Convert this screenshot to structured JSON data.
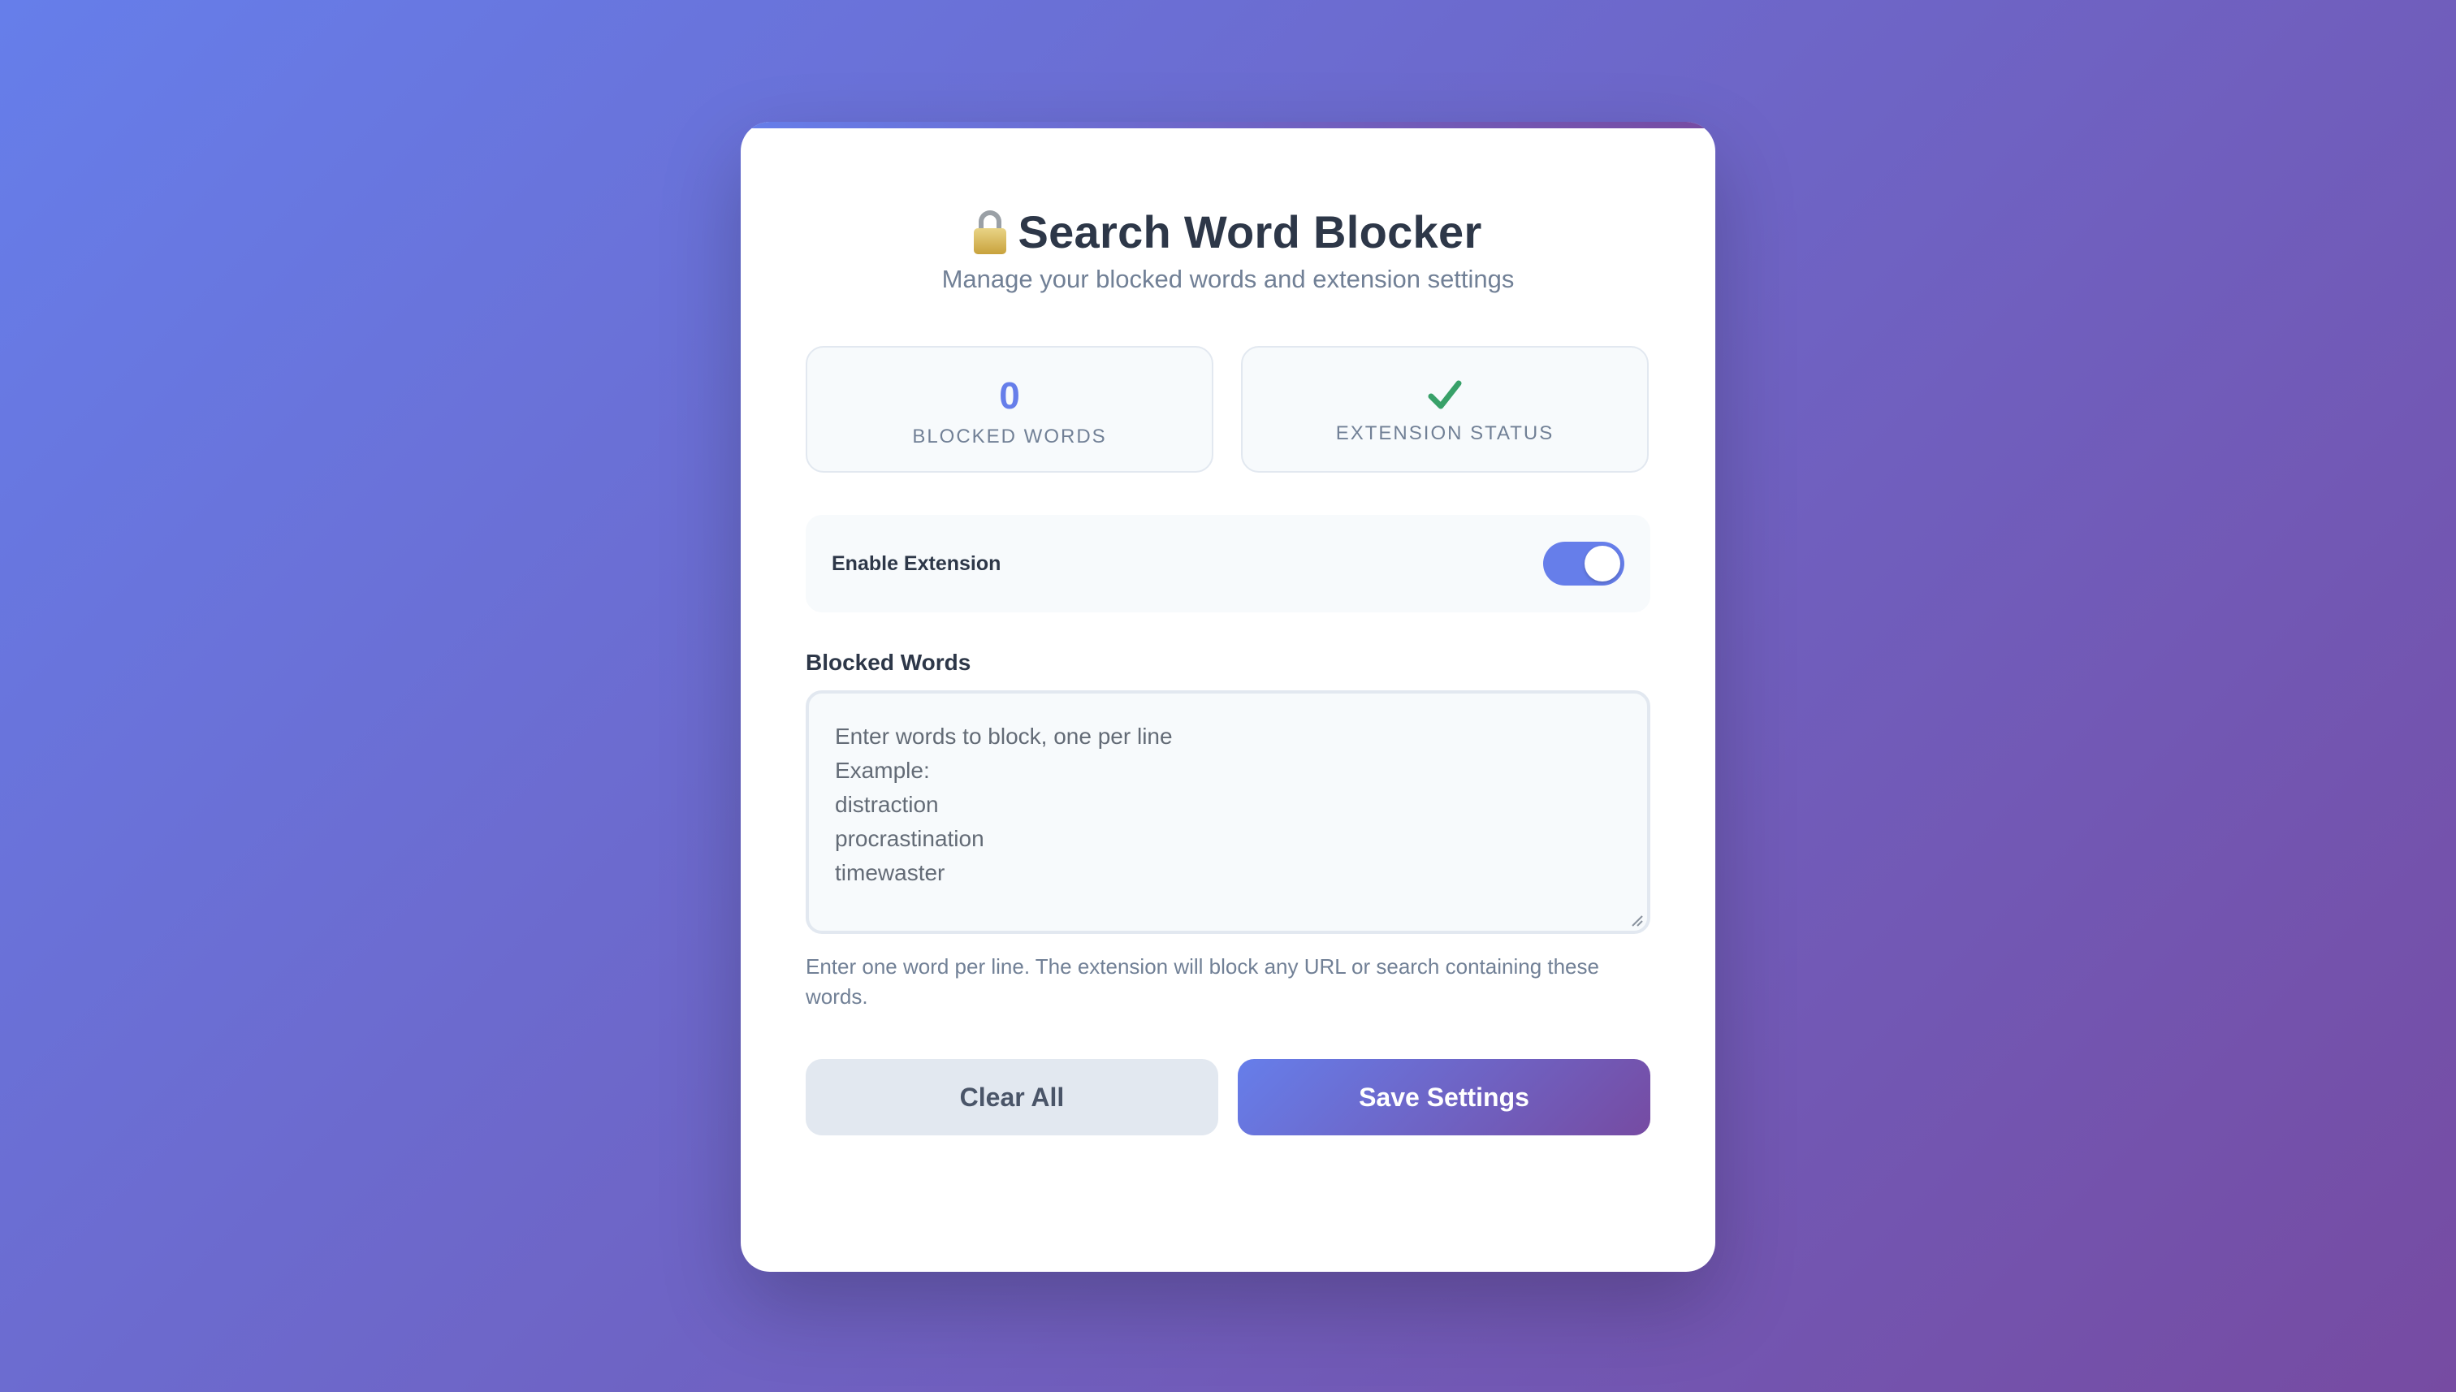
{
  "header": {
    "title_icon": "lock-icon",
    "title": "Search Word Blocker",
    "subtitle": "Manage your blocked words and extension settings"
  },
  "stats": {
    "blocked_words_count": "0",
    "blocked_words_label": "Blocked Words",
    "extension_status_icon": "check-icon",
    "extension_status_label": "Extension Status"
  },
  "toggle": {
    "label": "Enable Extension",
    "enabled": true
  },
  "blocked_words": {
    "label": "Blocked Words",
    "value": "",
    "placeholder_lines": [
      "Enter words to block, one per line",
      "Example:",
      "distraction",
      "procrastination",
      "timewaster"
    ],
    "help": "Enter one word per line. The extension will block any URL or search containing these words."
  },
  "actions": {
    "clear_label": "Clear All",
    "save_label": "Save Settings"
  },
  "colors": {
    "accent": "#667eea",
    "accent_end": "#764ba2",
    "success": "#38a169",
    "text_dark": "#2d3748",
    "text_muted": "#718096"
  }
}
